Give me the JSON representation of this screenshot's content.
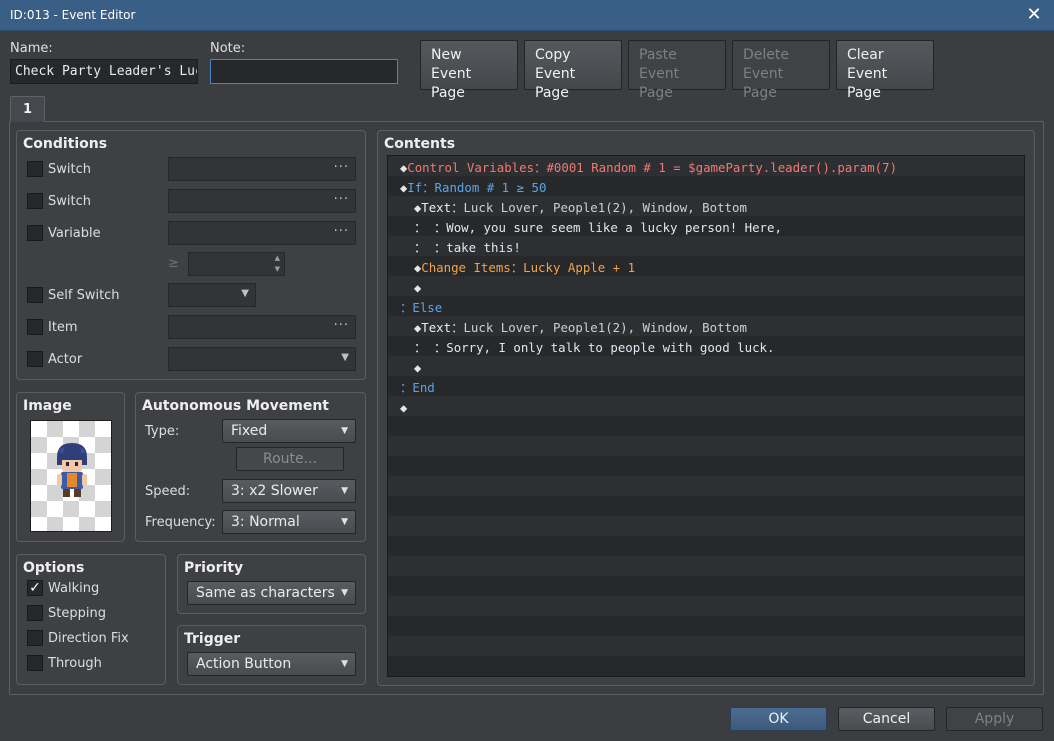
{
  "window": {
    "title": "ID:013 - Event Editor",
    "close_glyph": "✕"
  },
  "name": {
    "label": "Name:",
    "value": "Check Party Leader's Luck"
  },
  "note": {
    "label": "Note:",
    "value": ""
  },
  "page_buttons": [
    {
      "line1": "New",
      "line2": "Event Page",
      "enabled": true
    },
    {
      "line1": "Copy",
      "line2": "Event Page",
      "enabled": true
    },
    {
      "line1": "Paste",
      "line2": "Event Page",
      "enabled": false
    },
    {
      "line1": "Delete",
      "line2": "Event Page",
      "enabled": false
    },
    {
      "line1": "Clear",
      "line2": "Event Page",
      "enabled": true
    }
  ],
  "tabs": [
    {
      "label": "1",
      "selected": true
    }
  ],
  "conditions": {
    "title": "Conditions",
    "rows": [
      {
        "label": "Switch",
        "checked": false,
        "value": "",
        "control": "ellipsis"
      },
      {
        "label": "Switch",
        "checked": false,
        "value": "",
        "control": "ellipsis"
      },
      {
        "label": "Variable",
        "checked": false,
        "value": "",
        "control": "ellipsis"
      },
      {
        "label": "Self Switch",
        "checked": false,
        "value": "",
        "control": "dropdown"
      },
      {
        "label": "Item",
        "checked": false,
        "value": "",
        "control": "ellipsis"
      },
      {
        "label": "Actor",
        "checked": false,
        "value": "",
        "control": "dropdown"
      }
    ],
    "variable_operator": "≥",
    "variable_value": ""
  },
  "image": {
    "title": "Image",
    "icon": "character-sprite-icon"
  },
  "autonomous_movement": {
    "title": "Autonomous Movement",
    "type_label": "Type:",
    "type_value": "Fixed",
    "route_label": "Route...",
    "speed_label": "Speed:",
    "speed_value": "3: x2 Slower",
    "frequency_label": "Frequency:",
    "frequency_value": "3: Normal"
  },
  "options": {
    "title": "Options",
    "items": [
      {
        "label": "Walking",
        "checked": true
      },
      {
        "label": "Stepping",
        "checked": false
      },
      {
        "label": "Direction Fix",
        "checked": false
      },
      {
        "label": "Through",
        "checked": false
      }
    ]
  },
  "priority": {
    "title": "Priority",
    "value": "Same as characters"
  },
  "trigger": {
    "title": "Trigger",
    "value": "Action Button"
  },
  "contents": {
    "title": "Contents",
    "lines": [
      {
        "indent": 0,
        "diamond": true,
        "segments": [
          {
            "text": "Control Variables：#0001 Random # 1 = $gameParty.leader().param(7)",
            "color": "red"
          }
        ]
      },
      {
        "indent": 0,
        "diamond": true,
        "segments": [
          {
            "text": "If：Random # 1 ≥ 50",
            "color": "blue"
          }
        ]
      },
      {
        "indent": 1,
        "diamond": true,
        "segments": [
          {
            "text": "Text",
            "color": "white"
          },
          {
            "text": "：Luck Lover, People1(2), Window, Bottom",
            "color": "gray"
          }
        ]
      },
      {
        "indent": 1,
        "diamond": false,
        "segments": [
          {
            "text": "：     ：Wow, you sure seem like a lucky person! Here,",
            "color": "text"
          }
        ]
      },
      {
        "indent": 1,
        "diamond": false,
        "segments": [
          {
            "text": "：     ：take this!",
            "color": "text"
          }
        ]
      },
      {
        "indent": 1,
        "diamond": true,
        "segments": [
          {
            "text": "Change Items：Lucky Apple + 1",
            "color": "orange"
          }
        ]
      },
      {
        "indent": 1,
        "diamond": true,
        "segments": []
      },
      {
        "indent": 0,
        "diamond": false,
        "segments": [
          {
            "text": "：Else",
            "color": "blue"
          }
        ]
      },
      {
        "indent": 1,
        "diamond": true,
        "segments": [
          {
            "text": "Text",
            "color": "white"
          },
          {
            "text": "：Luck Lover, People1(2), Window, Bottom",
            "color": "gray"
          }
        ]
      },
      {
        "indent": 1,
        "diamond": false,
        "segments": [
          {
            "text": "：     ：Sorry, I only talk to people with good luck.",
            "color": "text"
          }
        ]
      },
      {
        "indent": 1,
        "diamond": true,
        "segments": []
      },
      {
        "indent": 0,
        "diamond": false,
        "segments": [
          {
            "text": "：End",
            "color": "blue"
          }
        ]
      },
      {
        "indent": 0,
        "diamond": true,
        "segments": []
      }
    ]
  },
  "footer": {
    "ok_label": "OK",
    "cancel_label": "Cancel",
    "apply_label": "Apply"
  },
  "colors": {
    "title_bar": "#3a5f86",
    "command_red": "#f07a72",
    "command_blue": "#5ea3ec",
    "command_orange": "#f4a24a"
  }
}
